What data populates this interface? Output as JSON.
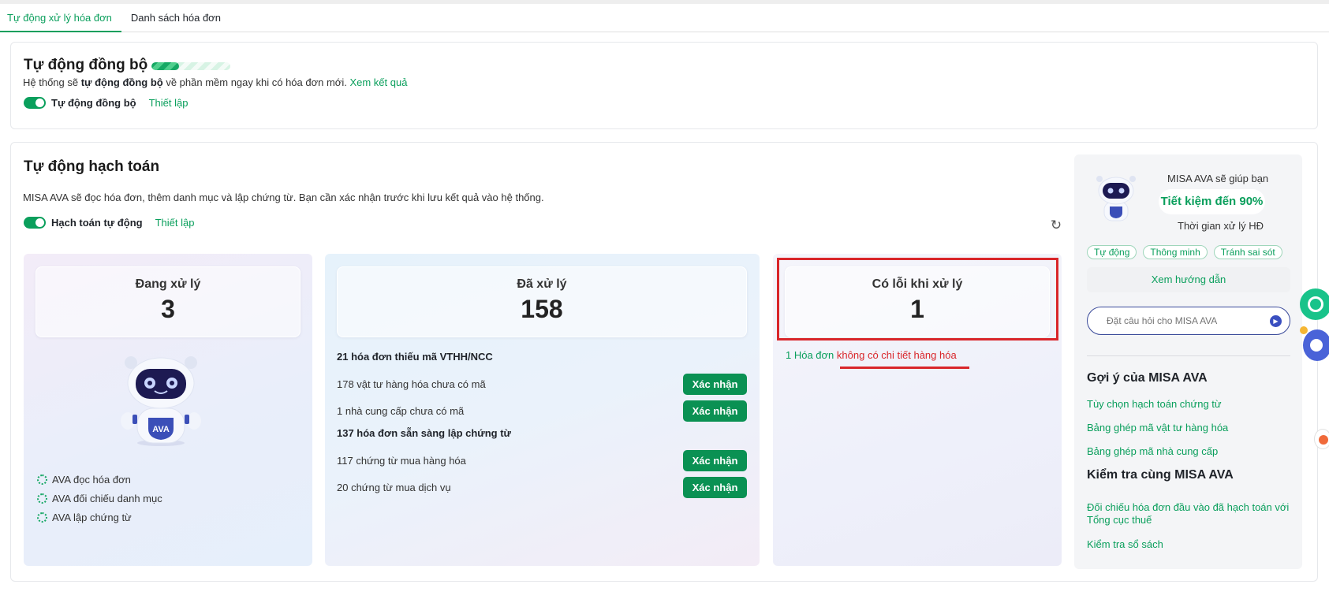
{
  "tabs": [
    {
      "label": "Tự động xử lý hóa đơn",
      "active": true
    },
    {
      "label": "Danh sách hóa đơn",
      "active": false
    }
  ],
  "sync": {
    "title": "Tự động đồng bộ",
    "progress": 0.35,
    "desc_prefix": "Hệ thống sẽ ",
    "desc_bold": "tự động đồng bộ",
    "desc_suffix": " về phần mềm ngay khi có hóa đơn mới. ",
    "result_link": "Xem kết quả",
    "toggle_label": "Tự động đồng bộ",
    "setup_link": "Thiết lập"
  },
  "accounting": {
    "title": "Tự động hạch toán",
    "desc": "MISA AVA sẽ đọc hóa đơn, thêm danh mục và lập chứng từ. Bạn cần xác nhận trước khi lưu kết quả vào hệ thống.",
    "toggle_label": "Hạch toán tự động",
    "setup_link": "Thiết lập",
    "refresh_icon": "↻"
  },
  "processing": {
    "label": "Đang xử lý",
    "count": "3",
    "steps": [
      "AVA đọc hóa đơn",
      "AVA đối chiếu danh mục",
      "AVA lập chứng từ"
    ]
  },
  "processed": {
    "label": "Đã xử lý",
    "count": "158",
    "group1": "21 hóa đơn thiếu mã VTHH/NCC",
    "group1_items": [
      {
        "text": "178 vật tư hàng hóa chưa có mã",
        "button": "Xác nhận"
      },
      {
        "text": "1 nhà cung cấp chưa có mã",
        "button": "Xác nhận"
      }
    ],
    "group2": "137 hóa đơn sẵn sàng lập chứng từ",
    "group2_items": [
      {
        "text": "117 chứng từ mua hàng hóa",
        "button": "Xác nhận"
      },
      {
        "text": "20 chứng từ mua dịch vụ",
        "button": "Xác nhận"
      }
    ]
  },
  "errors": {
    "label": "Có lỗi khi xử lý",
    "count": "1",
    "line_prefix": "1 Hóa đơn ",
    "line_link": "không có chi tiết hàng hóa"
  },
  "side": {
    "line1": "MISA AVA sẽ giúp bạn",
    "highlight": "Tiết kiệm đến 90%",
    "line2": "Thời gian xử lý HĐ",
    "chips": [
      "Tự động",
      "Thông minh",
      "Tránh sai sót"
    ],
    "guide": "Xem hướng dẫn",
    "ask_placeholder": "Đặt câu hỏi cho MISA AVA",
    "suggest_title": "Gợi ý của MISA AVA",
    "suggest_links": [
      "Tùy chọn hạch toán chứng từ",
      "Bảng ghép mã vật tư hàng hóa",
      "Bảng ghép mã nhà cung cấp"
    ],
    "check_title": "Kiểm tra cùng MISA AVA",
    "check_links": [
      "Đối chiếu hóa đơn đầu vào đã hạch toán với Tổng cục thuế",
      "Kiểm tra sổ sách"
    ]
  },
  "colors": {
    "accent": "#0a9f5c",
    "button": "#0a9153",
    "error": "#d9262a"
  }
}
